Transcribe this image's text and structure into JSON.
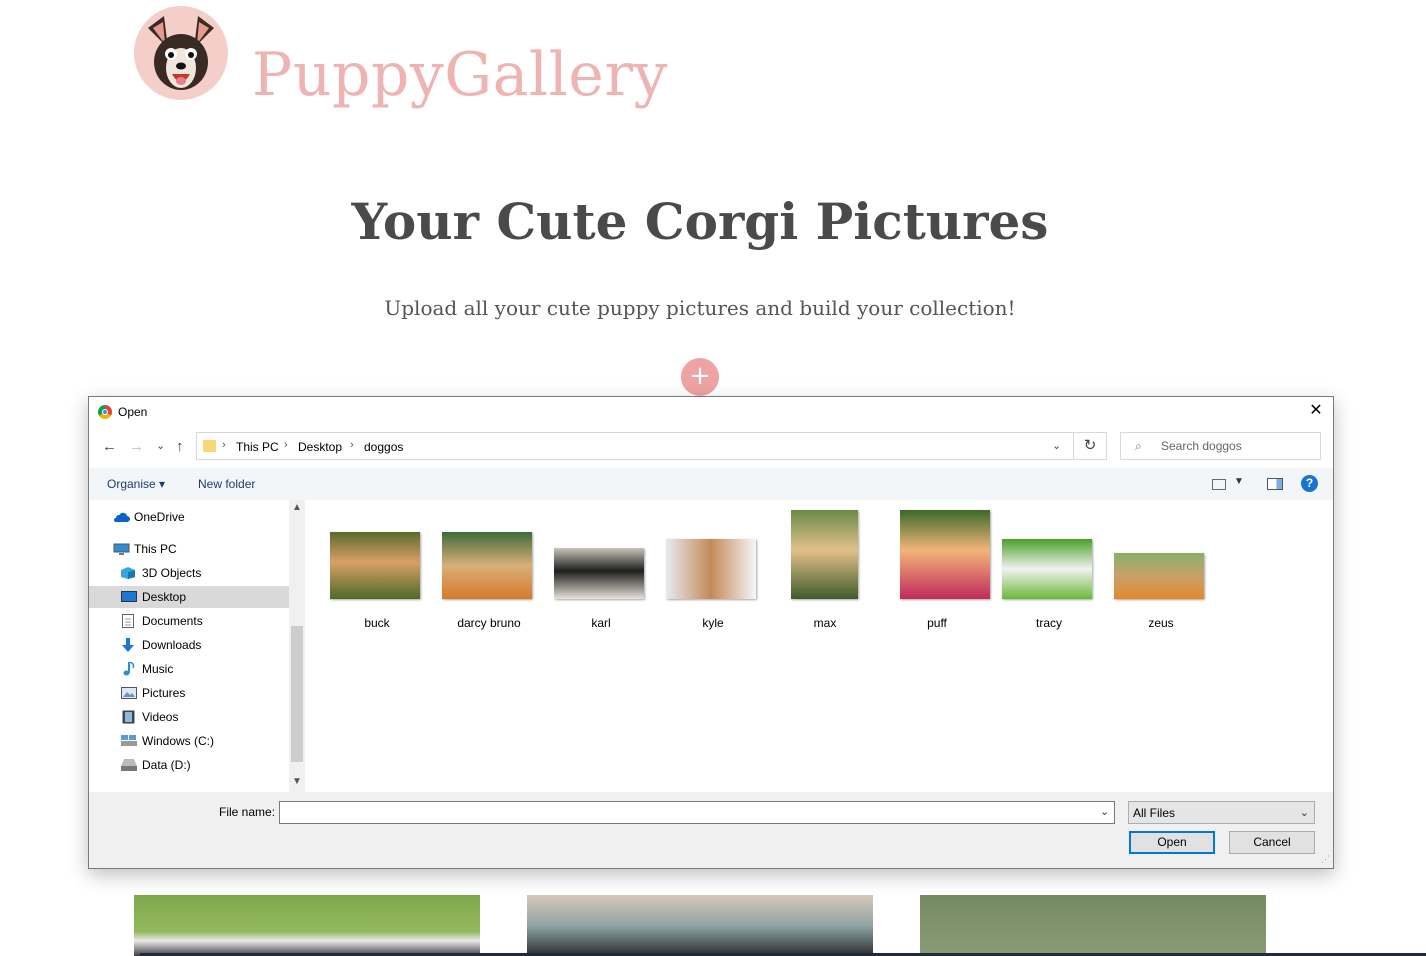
{
  "page": {
    "brand": "PuppyGallery",
    "title": "Your Cute Corgi Pictures",
    "subtitle": "Upload all your cute puppy pictures and build your collection!",
    "add_button": "+"
  },
  "dialog": {
    "title": "Open",
    "close_glyph": "✕",
    "nav": {
      "back": "←",
      "forward": "→",
      "recent": "⌄",
      "up": "↑"
    },
    "breadcrumb": [
      "This PC",
      "Desktop",
      "doggos"
    ],
    "refresh_glyph": "↻",
    "search_placeholder": "Search doggos",
    "toolbar": {
      "organise": "Organise ▾",
      "new_folder": "New folder"
    },
    "help_glyph": "?",
    "sidebar": [
      {
        "label": "OneDrive",
        "icon": "onedrive-icon",
        "color": "#0a64c8"
      },
      {
        "label": "This PC",
        "icon": "pc-icon",
        "color": "#2f8bd8"
      },
      {
        "label": "3D Objects",
        "icon": "cube-icon",
        "color": "#3aa6e0"
      },
      {
        "label": "Desktop",
        "icon": "desktop-icon",
        "color": "#1a78d4",
        "selected": true
      },
      {
        "label": "Documents",
        "icon": "document-icon",
        "color": "#8aa0b8"
      },
      {
        "label": "Downloads",
        "icon": "download-icon",
        "color": "#1a78d4"
      },
      {
        "label": "Music",
        "icon": "music-icon",
        "color": "#2f8bd8"
      },
      {
        "label": "Pictures",
        "icon": "pictures-icon",
        "color": "#6f93b8"
      },
      {
        "label": "Videos",
        "icon": "video-icon",
        "color": "#444444"
      },
      {
        "label": "Windows (C:)",
        "icon": "drive-c-icon",
        "color": "#5b9bd5"
      },
      {
        "label": "Data (D:)",
        "icon": "drive-d-icon",
        "color": "#777777"
      }
    ],
    "files": [
      {
        "name": "buck",
        "colors": [
          "#5a6a2e",
          "#d9a066",
          "#4c6a2a"
        ]
      },
      {
        "name": "darcy bruno",
        "colors": [
          "#3f6a3a",
          "#d8b078",
          "#d67a2a"
        ]
      },
      {
        "name": "karl",
        "colors": [
          "#c9c3ba",
          "#1e1e1e",
          "#e8e2d8"
        ]
      },
      {
        "name": "kyle",
        "colors": [
          "#e8eaf0",
          "#c48a58",
          "#f6f6f8"
        ]
      },
      {
        "name": "max",
        "colors": [
          "#6a8a4a",
          "#e2c08a",
          "#3f5a2a"
        ]
      },
      {
        "name": "puff",
        "colors": [
          "#3a6a2a",
          "#f2b57a",
          "#c02a5a"
        ]
      },
      {
        "name": "tracy",
        "colors": [
          "#4aa02a",
          "#f2f2f2",
          "#6ab83a"
        ]
      },
      {
        "name": "zeus",
        "colors": [
          "#8ab06a",
          "#c9a06a",
          "#e08a2a"
        ]
      }
    ],
    "file_name_label": "File name:",
    "file_name_value": "",
    "filter": "All Files",
    "open_button": "Open",
    "cancel_button": "Cancel"
  },
  "colors": {
    "brand": "#eeb4b1",
    "accent": "#eea3a3",
    "title": "#4a4a4a",
    "selection": "#d9d9d9",
    "primary_border": "#0078d7"
  }
}
